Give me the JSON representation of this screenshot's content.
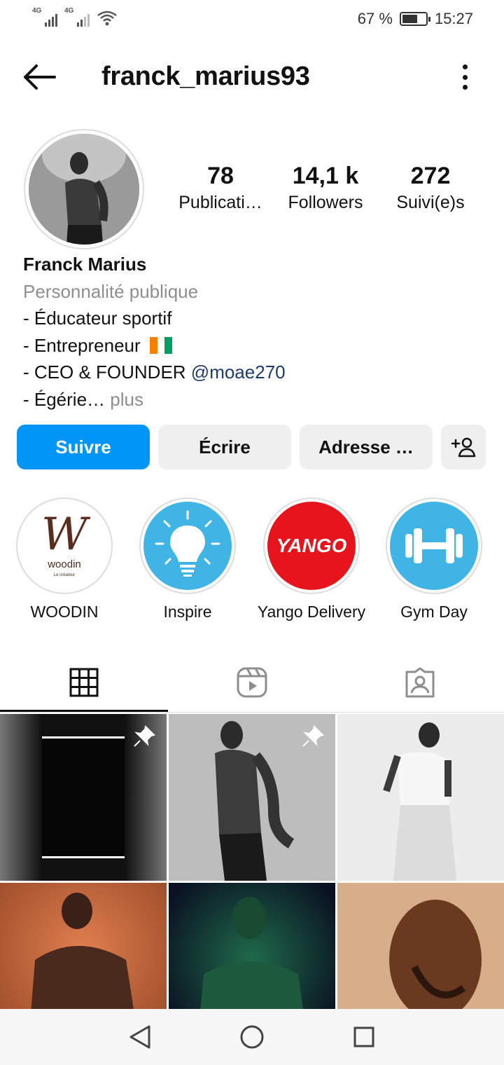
{
  "status_bar": {
    "signal1": "4G",
    "signal2": "4G",
    "battery_percent": "67 %",
    "battery_level": 0.67,
    "time": "15:27"
  },
  "header": {
    "username": "franck_marius93"
  },
  "profile": {
    "stats": [
      {
        "value": "78",
        "label": "Publicati…"
      },
      {
        "value": "14,1 k",
        "label": "Followers"
      },
      {
        "value": "272",
        "label": "Suivi(e)s"
      }
    ],
    "name": "Franck Marius",
    "category": "Personnalité publique",
    "bio_line1": "- Éducateur sportif",
    "bio_line2": "- Entrepreneur",
    "bio_line3_prefix": "- CEO & FOUNDER ",
    "bio_line3_mention": "@moae270",
    "bio_line4": "- Égérie…",
    "bio_more": " plus"
  },
  "actions": {
    "follow": "Suivre",
    "message": "Écrire",
    "address": "Adresse …"
  },
  "highlights": [
    {
      "label": "WOODIN",
      "logo_text": "woodin",
      "logo_sub": "Le créateur"
    },
    {
      "label": "Inspire"
    },
    {
      "label": "Yango Delivery",
      "logo_text": "YANGO"
    },
    {
      "label": "Gym Day"
    }
  ],
  "tabs": [
    "grid-icon",
    "reels-icon",
    "tagged-icon"
  ],
  "colors": {
    "accent": "#0095f6",
    "mention": "#1e3a6e",
    "muted": "#8e8e8e",
    "yango": "#e8141c",
    "inspire": "#3fb4e5"
  }
}
